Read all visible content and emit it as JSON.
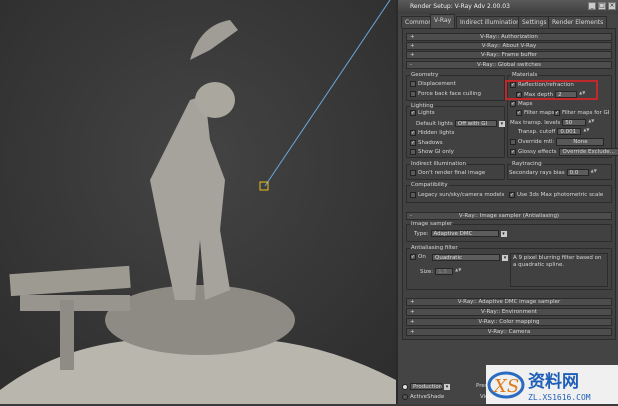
{
  "window": {
    "title": "Render Setup: V-Ray Adv 2.00.03",
    "min": "_",
    "max": "□",
    "close": "×"
  },
  "tabs": [
    {
      "label": "Common"
    },
    {
      "label": "V-Ray"
    },
    {
      "label": "Indirect illumination"
    },
    {
      "label": "Settings"
    },
    {
      "label": "Render Elements"
    }
  ],
  "active_tab": "V-Ray",
  "rollouts_top": [
    {
      "sign": "+",
      "label": "V-Ray:: Authorization"
    },
    {
      "sign": "+",
      "label": "V-Ray:: About V-Ray"
    },
    {
      "sign": "+",
      "label": "V-Ray:: Frame buffer"
    },
    {
      "sign": "-",
      "label": "V-Ray:: Global switches"
    }
  ],
  "geometry": {
    "label": "Geometry",
    "displacement": {
      "label": "Displacement",
      "checked": false
    },
    "backface": {
      "label": "Force back face culling",
      "checked": false
    }
  },
  "lighting": {
    "label": "Lighting",
    "lights": {
      "label": "Lights",
      "checked": true
    },
    "default_lights_label": "Default lights",
    "default_lights_value": "Off with GI",
    "hidden_lights": {
      "label": "Hidden lights",
      "checked": true
    },
    "shadows": {
      "label": "Shadows",
      "checked": true
    },
    "show_gi_only": {
      "label": "Show GI only",
      "checked": false
    }
  },
  "materials": {
    "label": "Materials",
    "reflection": {
      "label": "Reflection/refraction",
      "checked": true
    },
    "max_depth": {
      "label": "Max depth",
      "checked": true,
      "value": "2"
    },
    "maps": {
      "label": "Maps",
      "checked": true
    },
    "filter_maps": {
      "label": "Filter maps",
      "checked": true
    },
    "filter_maps_gi": {
      "label": "Filter maps for GI",
      "checked": true
    },
    "max_transp_label": "Max transp. levels",
    "max_transp_value": "50",
    "transp_cutoff_label": "Transp. cutoff",
    "transp_cutoff_value": "0.001",
    "override_mtl": {
      "label": "Override mtl:",
      "checked": false
    },
    "override_btn": "None",
    "glossy": {
      "label": "Glossy effects",
      "checked": true
    },
    "override_exclude": "Override Exclude..."
  },
  "highlight_color": "#c0282a",
  "indirect": {
    "label": "Indirect illumination",
    "dont_render": {
      "label": "Don't render final image",
      "checked": false
    }
  },
  "raytracing": {
    "label": "Raytracing",
    "secondary_bias_label": "Secondary rays bias",
    "secondary_bias_value": "0.0"
  },
  "compat": {
    "label": "Compatibility",
    "legacy": {
      "label": "Legacy sun/sky/camera models",
      "checked": false
    },
    "photometric": {
      "label": "Use 3ds Max photometric scale",
      "checked": true
    }
  },
  "image_sampler_rollout": {
    "sign": "-",
    "label": "V-Ray:: Image sampler (Antialiasing)"
  },
  "image_sampler": {
    "label": "Image sampler",
    "type_label": "Type:",
    "type_value": "Adaptive DMC"
  },
  "aa_filter": {
    "label": "Antialiasing filter",
    "on": {
      "label": "On",
      "checked": true
    },
    "filter_value": "Quadratic",
    "size_label": "Size:",
    "size_value": "1.5",
    "description": "A 9 pixel blurring filter based on a quadratic spline."
  },
  "rollouts_bottom": [
    {
      "sign": "+",
      "label": "V-Ray:: Adaptive DMC image sampler"
    },
    {
      "sign": "+",
      "label": "V-Ray:: Environment"
    },
    {
      "sign": "+",
      "label": "V-Ray:: Color mapping"
    },
    {
      "sign": "+",
      "label": "V-Ray:: Camera"
    }
  ],
  "bottom": {
    "production": "Production",
    "activeshade": "ActiveShade",
    "preset": "Preset",
    "view": "View"
  },
  "watermark": {
    "logo": "XS",
    "cn": "资料网",
    "url": "ZL.XS1616.COM"
  }
}
